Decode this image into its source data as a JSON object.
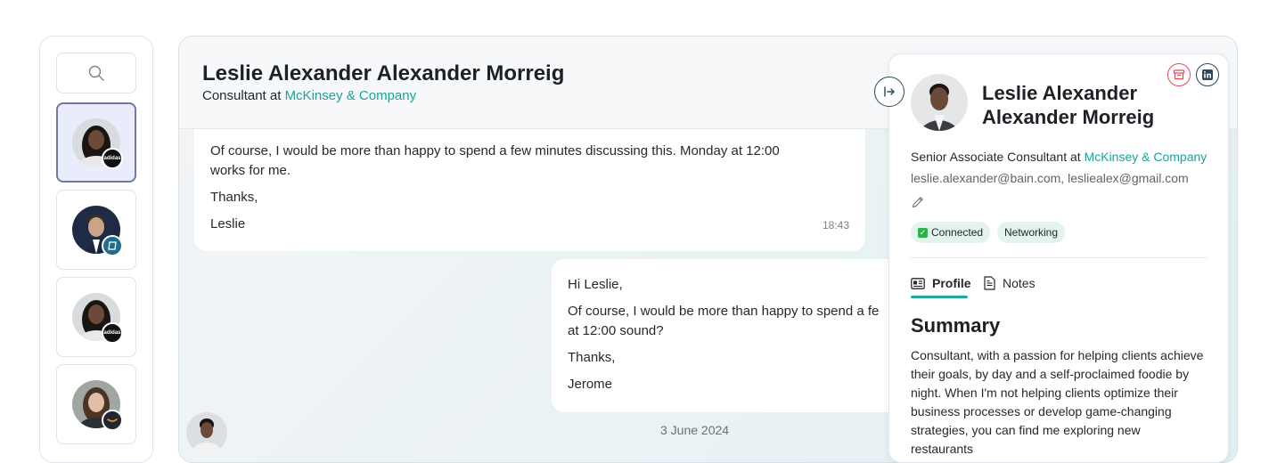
{
  "sidebar": {
    "search_icon": "search-icon",
    "contacts": [
      {
        "badge": "adidas",
        "badge_color": "#111111",
        "skin": "#6b4a3a",
        "hair": "#1a1412",
        "active": true
      },
      {
        "badge": "",
        "badge_color": "#1f6e8c",
        "skin": "#c9a487",
        "hair": "#3a2c22",
        "active": false
      },
      {
        "badge": "adidas",
        "badge_color": "#111111",
        "skin": "#6b4a3a",
        "hair": "#1a1412",
        "active": false
      },
      {
        "badge": "",
        "badge_color": "#222831",
        "skin": "#e2bea4",
        "hair": "#4a3426",
        "active": false
      }
    ]
  },
  "chat": {
    "title": "Leslie Alexander Alexander Morreig",
    "subtitle_prefix": "Consultant at ",
    "subtitle_company": "McKinsey & Company",
    "messages": [
      {
        "lines": [
          "Of course, I would be more than happy to spend a few minutes discussing this. Monday at 12:00 works for me.",
          "Thanks,",
          "Leslie"
        ],
        "time": "18:43"
      },
      {
        "lines": [
          "Hi Leslie,",
          "Of course, I would be more than happy to spend a fe",
          "at 12:00 sound?",
          "Thanks,",
          "Jerome"
        ]
      }
    ],
    "date_separator": "3 June 2024"
  },
  "profile": {
    "name": "Leslie Alexander Alexander Morreig",
    "role_prefix": "Senior Associate Consultant at ",
    "role_company": "McKinsey & Company",
    "emails": "leslie.alexander@bain.com, lesliealex@gmail.com",
    "tags": [
      "Connected",
      "Networking"
    ],
    "tabs": [
      "Profile",
      "Notes"
    ],
    "summary_title": "Summary",
    "summary_text": "Consultant, with a passion for helping clients achieve their goals, by day and a self-proclaimed foodie by night. When I'm not helping clients optimize their business processes or develop game-changing strategies, you can find me exploring new restaurants"
  },
  "colors": {
    "accent": "#1aa39b",
    "active_contact_border": "#6f77a5",
    "archive_red": "#e04b5a",
    "connected_green": "#2fb24a"
  }
}
